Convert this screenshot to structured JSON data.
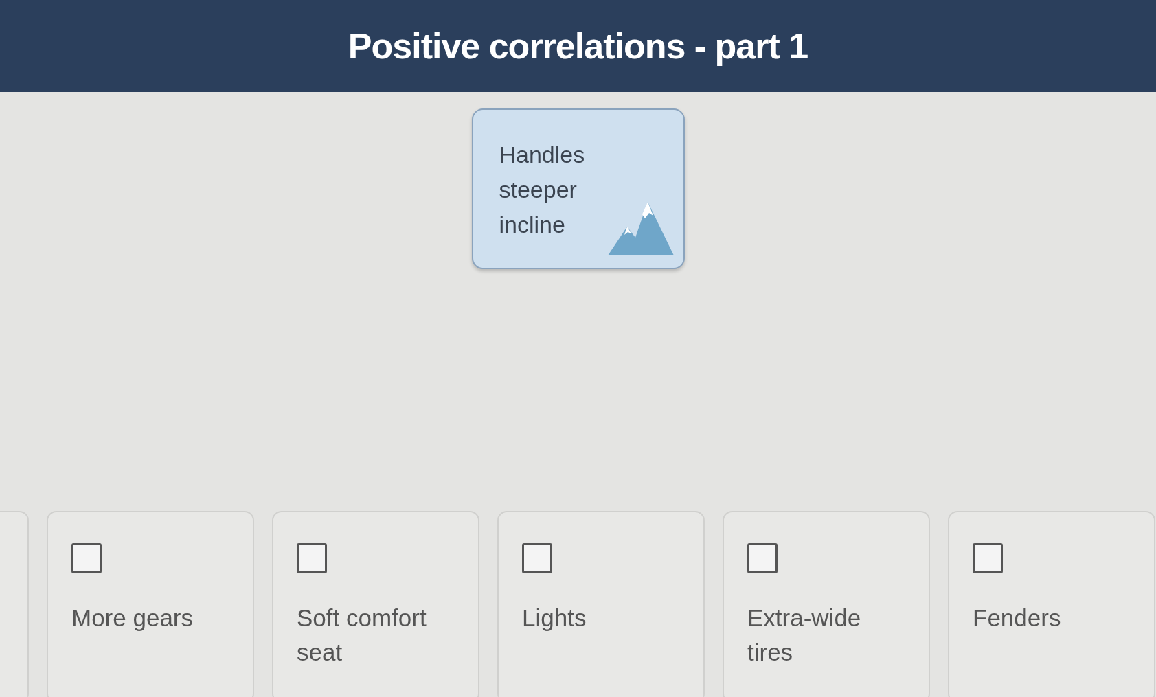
{
  "header": {
    "title": "Positive correlations - part 1"
  },
  "prompt_card": {
    "text": "Handles steeper incline"
  },
  "options": [
    {
      "label": "More gears",
      "checked": false
    },
    {
      "label": "Soft comfort seat",
      "checked": false
    },
    {
      "label": "Lights",
      "checked": false
    },
    {
      "label": "Extra-wide tires",
      "checked": false
    },
    {
      "label": "Fenders",
      "checked": false
    }
  ]
}
